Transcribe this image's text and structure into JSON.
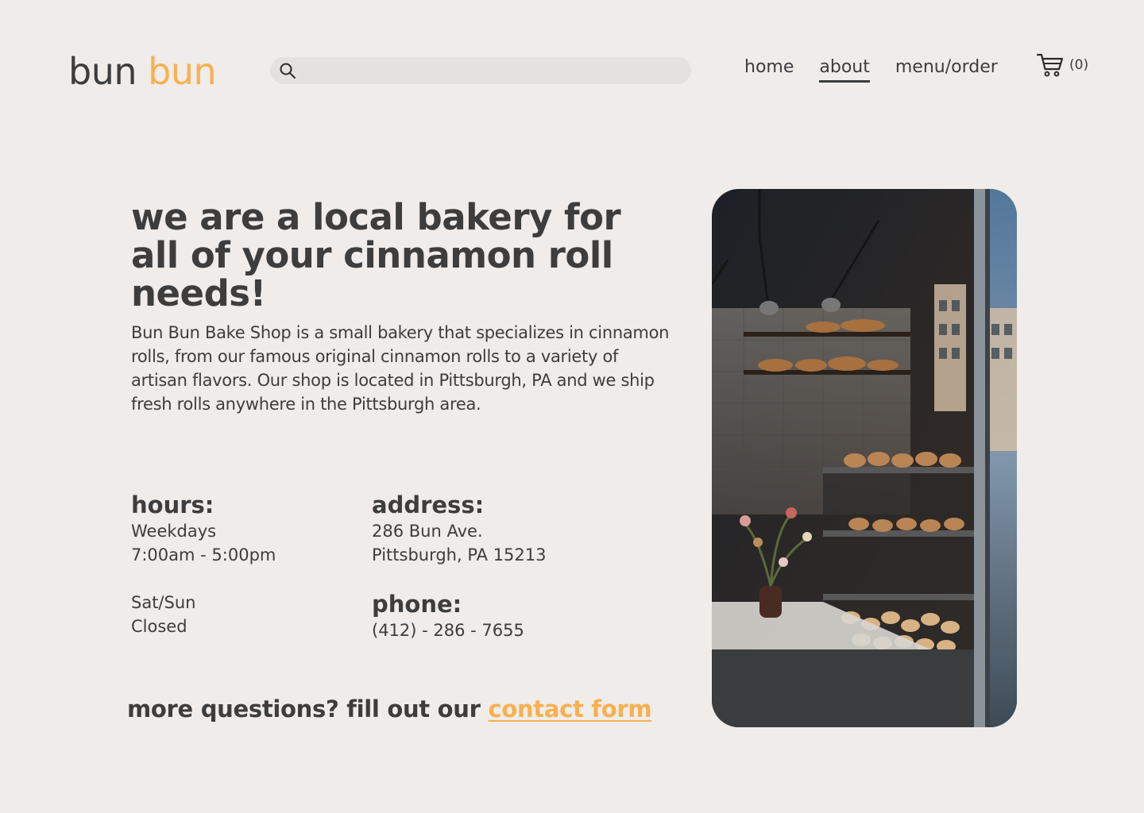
{
  "logo": {
    "word1": "bun",
    "word2": "bun"
  },
  "search": {
    "placeholder": "",
    "value": ""
  },
  "nav": {
    "home": "home",
    "about": "about",
    "menu": "menu/order"
  },
  "cart": {
    "count_label": "(0)"
  },
  "main": {
    "headline": "we are a local bakery for all of your cinnamon roll needs!",
    "intro": "Bun Bun Bake Shop is a small bakery that specializes in cinnamon rolls, from our famous original cinnamon rolls to a variety of artisan flavors. Our shop is located in Pittsburgh, PA and we ship fresh rolls anywhere in the Pittsburgh area."
  },
  "hours": {
    "title": "hours:",
    "weekdays_label": "Weekdays",
    "weekdays_time": "7:00am - 5:00pm",
    "weekend_label": "Sat/Sun",
    "weekend_status": "Closed"
  },
  "address": {
    "title": "address:",
    "line1": "286 Bun Ave.",
    "line2": "Pittsburgh, PA 15213"
  },
  "phone": {
    "title": "phone:",
    "number": "(412) - 286 - 7655"
  },
  "contact": {
    "prefix": "more questions? fill out our ",
    "link": "contact form"
  },
  "colors": {
    "background": "#efecea",
    "text": "#3d3d3d",
    "accent": "#f8b04f",
    "search_bg": "#e5e1de"
  },
  "icons": {
    "search": "search-icon",
    "cart": "cart-icon"
  }
}
